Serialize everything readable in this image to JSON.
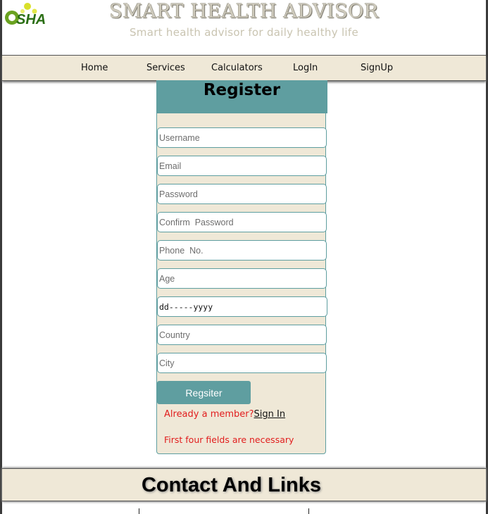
{
  "header": {
    "logo_text": "SHA",
    "title": "SMART HEALTH ADVISOR",
    "subtitle": "Smart health advisor for daily healthy life"
  },
  "nav": {
    "items": [
      {
        "label": "Home"
      },
      {
        "label": "Services"
      },
      {
        "label": "Calculators"
      },
      {
        "label": "LogIn"
      },
      {
        "label": "SignUp"
      }
    ]
  },
  "register": {
    "title": "Register",
    "fields": [
      {
        "placeholder": "Username"
      },
      {
        "placeholder": "Email"
      },
      {
        "placeholder": "Password"
      },
      {
        "placeholder": "Confirm  Password"
      },
      {
        "placeholder": "Phone  No."
      },
      {
        "placeholder": "Age"
      },
      {
        "placeholder": "dd-----yyyy"
      },
      {
        "placeholder": "Country"
      },
      {
        "placeholder": "City"
      }
    ],
    "submit_label": "Regsiter",
    "member_text": "Already a member?",
    "signin_label": "Sign In",
    "note": "First four fields are necessary"
  },
  "footer": {
    "title": "Contact And Links"
  },
  "colors": {
    "accent": "#5f9ea0",
    "panel_bg": "#efe8d7",
    "warning_text": "#e11d1d"
  }
}
